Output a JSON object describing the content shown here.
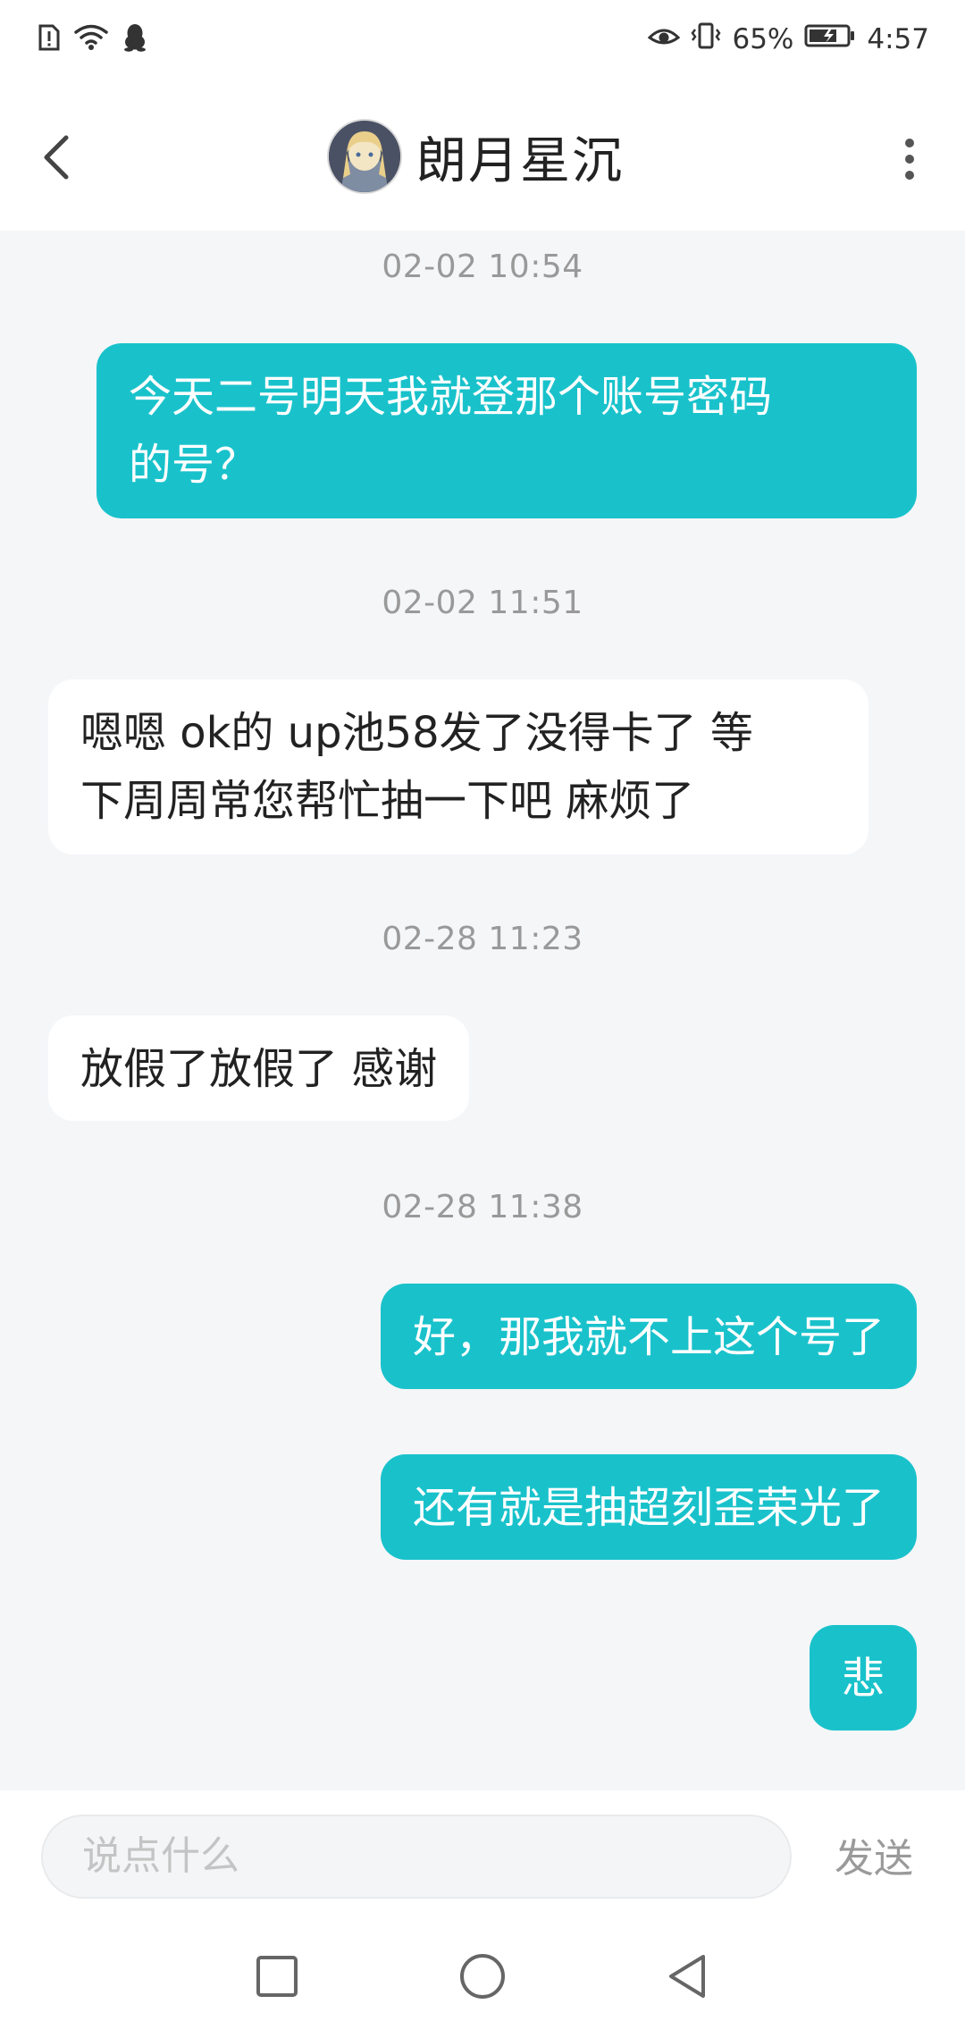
{
  "status_bar": {
    "battery_percent": "65%",
    "time": "4:57",
    "left_icons": [
      "sim-alert-icon",
      "wifi-icon",
      "qq-penguin-icon"
    ],
    "right_icons": [
      "eye-icon",
      "vibrate-icon",
      "battery-icon"
    ]
  },
  "header": {
    "title": "朗月星沉",
    "back_icon": "chevron-left-icon",
    "more_icon": "more-vertical-icon"
  },
  "messages": [
    {
      "type": "timestamp",
      "text": "02-02 10:54"
    },
    {
      "type": "outgoing",
      "lines": [
        "今天二号明天我就登那个账号密码",
        "的号？"
      ]
    },
    {
      "type": "timestamp",
      "text": "02-02 11:51"
    },
    {
      "type": "incoming",
      "lines": [
        "嗯嗯 ok的 up池58发了没得卡了 等",
        "下周周常您帮忙抽一下吧 麻烦了"
      ]
    },
    {
      "type": "timestamp",
      "text": "02-28 11:23"
    },
    {
      "type": "incoming",
      "lines": [
        "放假了放假了 感谢"
      ]
    },
    {
      "type": "timestamp",
      "text": "02-28 11:38"
    },
    {
      "type": "outgoing",
      "lines": [
        "好，那我就不上这个号了"
      ]
    },
    {
      "type": "outgoing",
      "lines": [
        "还有就是抽超刻歪荣光了"
      ]
    },
    {
      "type": "outgoing",
      "lines": [
        "悲"
      ]
    }
  ],
  "input": {
    "placeholder": "说点什么",
    "send_label": "发送"
  },
  "nav_bar": {
    "icons": [
      "recent-apps-square-icon",
      "home-circle-icon",
      "back-triangle-icon"
    ]
  },
  "colors": {
    "outgoing_bubble": "#19c2cb",
    "incoming_bubble": "#ffffff",
    "chat_background": "#f5f6f8",
    "timestamp_text": "#999999"
  }
}
